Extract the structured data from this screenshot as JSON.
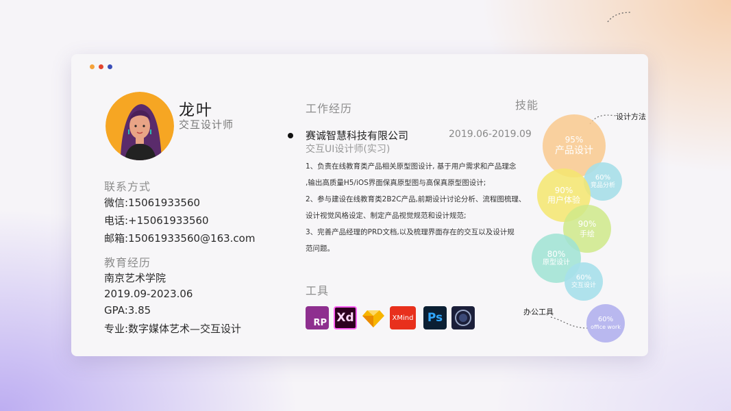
{
  "profile": {
    "name": "龙叶",
    "title": "交互设计师"
  },
  "contact": {
    "heading": "联系方式",
    "wechat": "微信:15061933560",
    "phone": "电话:+15061933560",
    "email": "邮箱:15061933560@163.com"
  },
  "education": {
    "heading": "教育经历",
    "school": "南京艺术学院",
    "period": "2019.09-2023.06",
    "gpa": "GPA:3.85",
    "major": "专业:数字媒体艺术—交互设计"
  },
  "work": {
    "heading": "工作经历",
    "company": "赛诚智慧科技有限公司",
    "period": "2019.06-2019.09",
    "role": "交互UI设计师(实习)",
    "duties": [
      "1、负责在线教育类产品相关原型图设计, 基于用户需求和产品理念",
      ",输出高质量H5/iOS界面保真原型图与高保真原型图设计;",
      "2、参与建设在线教育类2B2C产品,前期设计讨论分析、流程图梳理、",
      "设计视觉风格设定、制定产品视觉规范和设计规范;",
      "3、完善产品经理的PRD文档,以及梳理界面存在的交互以及设计规",
      "范问题。"
    ]
  },
  "tools": {
    "heading": "工具",
    "items": [
      {
        "label": "RP",
        "icon": "axure-rp-icon",
        "color": "#8e2f8f"
      },
      {
        "label": "Xd",
        "icon": "adobe-xd-icon",
        "color": "#2e001f"
      },
      {
        "label": "",
        "icon": "sketch-icon",
        "color": "#f7b500"
      },
      {
        "label": "XMind",
        "icon": "xmind-icon",
        "color": "#e8301c"
      },
      {
        "label": "Ps",
        "icon": "photoshop-icon",
        "color": "#0b1f33"
      },
      {
        "label": "",
        "icon": "cinema4d-icon",
        "color": "#1b1f3a"
      }
    ]
  },
  "skills": {
    "heading": "技能",
    "annotation_design_method": "设计方法",
    "annotation_office": "办公工具",
    "items": [
      {
        "percent": "95%",
        "label": "产品设计",
        "level": 0.95,
        "color": "#f9c98e"
      },
      {
        "percent": "60%",
        "label": "竞品分析",
        "level": 0.6,
        "color": "#a6dfe8"
      },
      {
        "percent": "90%",
        "label": "用户体验",
        "level": 0.9,
        "color": "#f5e66e"
      },
      {
        "percent": "90%",
        "label": "手绘",
        "level": 0.9,
        "color": "#cfe98a"
      },
      {
        "percent": "80%",
        "label": "原型设计",
        "level": 0.8,
        "color": "#9fe3d3"
      },
      {
        "percent": "60%",
        "label": "交互设计",
        "level": 0.6,
        "color": "#a6e0ea"
      },
      {
        "percent": "60%",
        "label": "office work",
        "level": 0.6,
        "color": "#b5b4ee"
      }
    ]
  },
  "window_dot_colors": [
    "#f5a33a",
    "#e2452f",
    "#3b4fb8"
  ]
}
